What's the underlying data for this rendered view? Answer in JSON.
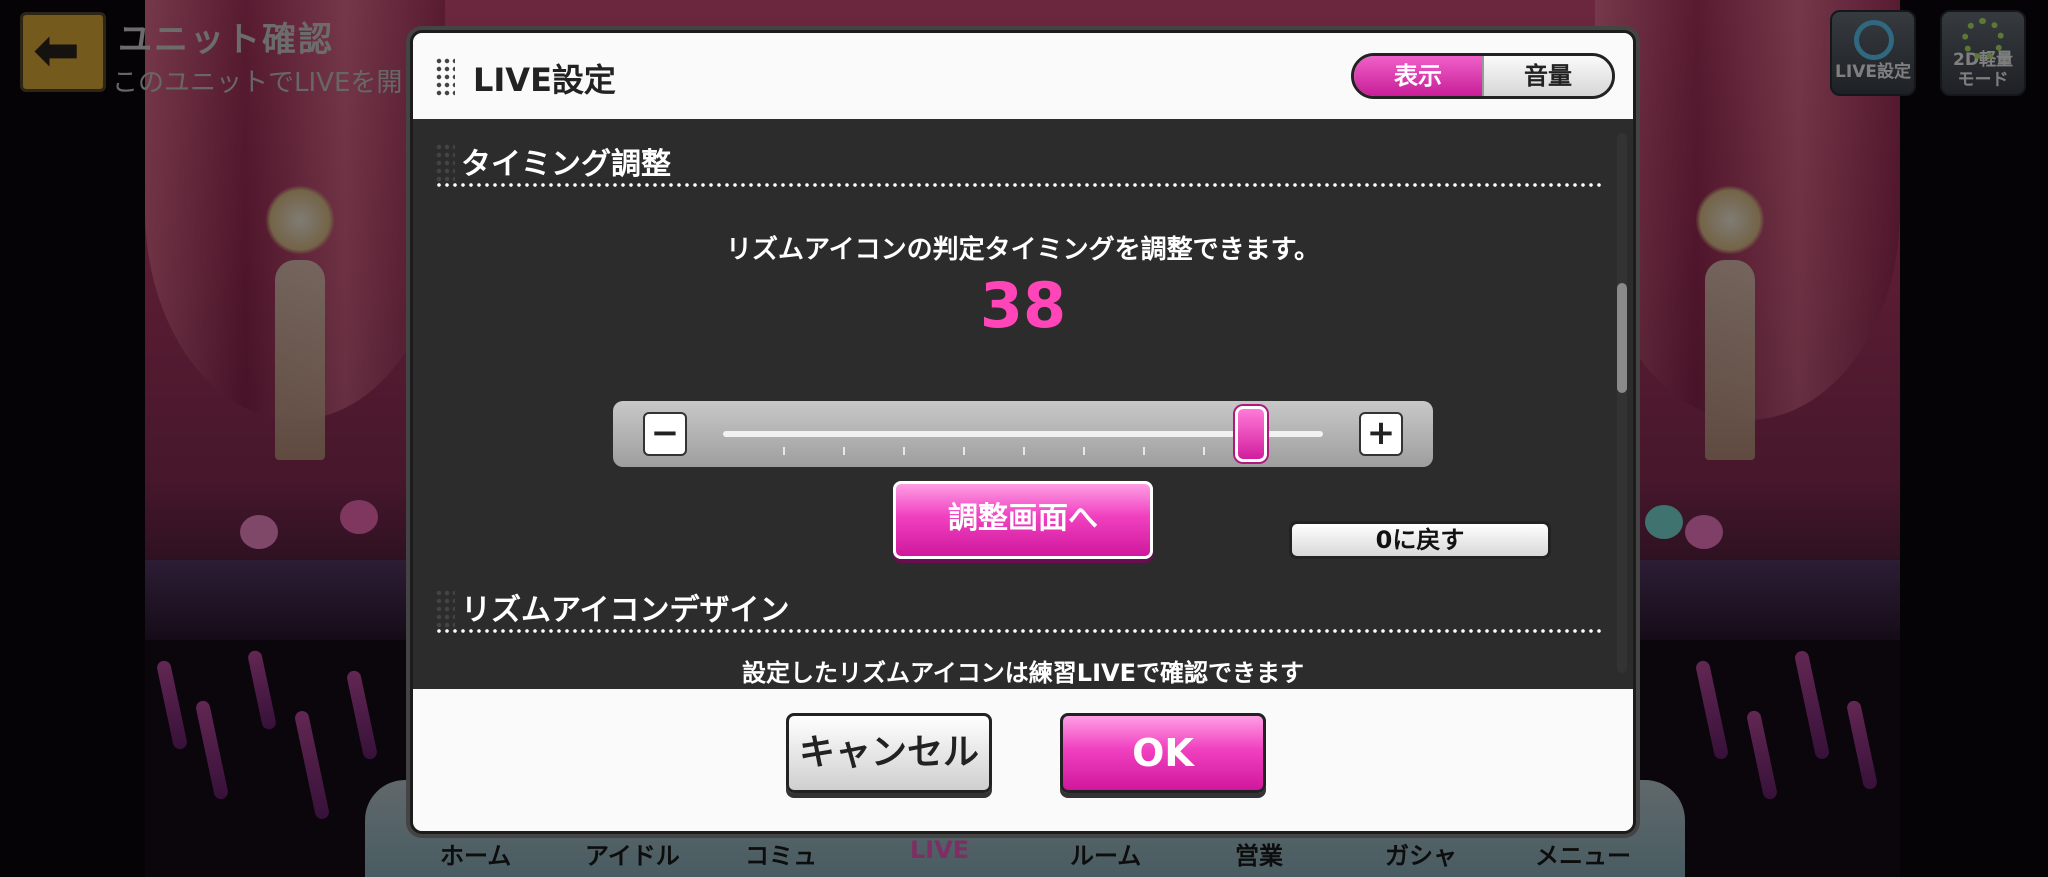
{
  "header": {
    "title": "ユニット確認",
    "subtitle": "このユニットでLIVEを開",
    "back_icon": "arrow-left-icon",
    "live_settings_label": "LIVE設定",
    "light_mode_label_1": "2D軽量",
    "light_mode_label_2": "モード"
  },
  "bottom_nav": {
    "items": [
      "ホーム",
      "アイドル",
      "コミュ",
      "LIVE",
      "ルーム",
      "営業",
      "ガシャ",
      "メニュー"
    ]
  },
  "modal": {
    "title": "LIVE設定",
    "tabs": {
      "display": "表示",
      "volume": "音量",
      "selected": "表示"
    },
    "timing": {
      "section_title": "タイミング調整",
      "description": "リズムアイコンの判定タイミングを調整できます。",
      "value": "38",
      "slider_fraction": 0.88,
      "minus_label": "−",
      "plus_label": "+",
      "adjust_button": "調整画面へ",
      "reset_button": "0に戻す"
    },
    "design": {
      "section_title": "リズムアイコンデザイン",
      "description": "設定したリズムアイコンは練習LIVEで確認できます"
    },
    "cancel_button": "キャンセル",
    "ok_button": "OK"
  },
  "colors": {
    "accent_pink": "#e62aa8",
    "value_pink": "#ff45b8"
  }
}
